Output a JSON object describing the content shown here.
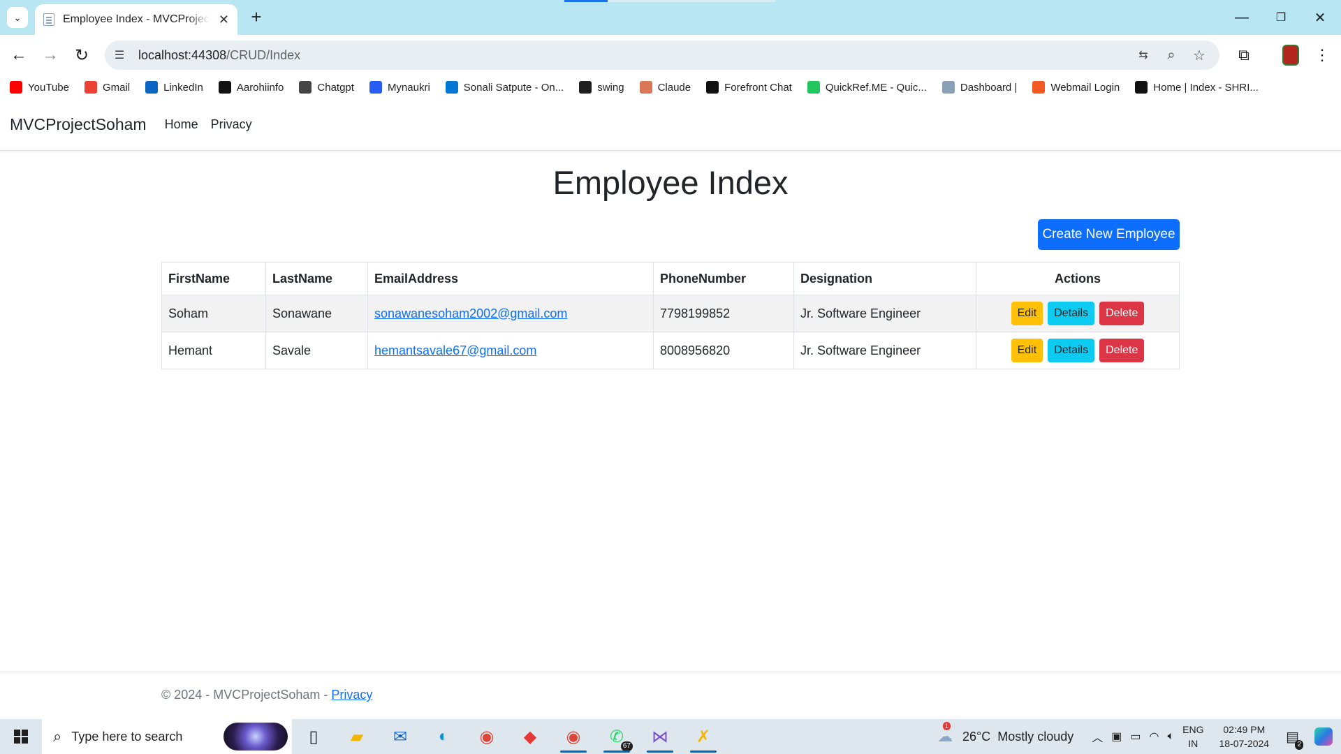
{
  "browser": {
    "tab_title": "Employee Index - MVCProjectSoham",
    "url_host": "localhost:44308",
    "url_path": "/CRUD/Index",
    "bookmarks": [
      {
        "label": "YouTube",
        "color": "#ff0000",
        "icon": "youtube-icon"
      },
      {
        "label": "Gmail",
        "color": "#ea4335",
        "icon": "gmail-icon"
      },
      {
        "label": "LinkedIn",
        "color": "#0a66c2",
        "icon": "linkedin-icon"
      },
      {
        "label": "Aarohiinfo",
        "color": "#111111",
        "icon": "aarohiinfo-icon"
      },
      {
        "label": "Chatgpt",
        "color": "#444444",
        "icon": "chatgpt-icon"
      },
      {
        "label": "Mynaukri",
        "color": "#275df5",
        "icon": "mynaukri-icon"
      },
      {
        "label": "Sonali Satpute - On...",
        "color": "#0078d4",
        "icon": "onedrive-icon"
      },
      {
        "label": "swing",
        "color": "#1f1f1f",
        "icon": "github-icon"
      },
      {
        "label": "Claude",
        "color": "#d97757",
        "icon": "claude-icon"
      },
      {
        "label": "Forefront Chat",
        "color": "#111111",
        "icon": "forefront-icon"
      },
      {
        "label": "QuickRef.ME - Quic...",
        "color": "#22c55e",
        "icon": "quickref-icon"
      },
      {
        "label": "Dashboard |",
        "color": "#8aa0b6",
        "icon": "page-icon"
      },
      {
        "label": "Webmail Login",
        "color": "#f15a24",
        "icon": "webmail-icon"
      },
      {
        "label": "Home | Index - SHRI...",
        "color": "#111111",
        "icon": "home-h-icon"
      }
    ]
  },
  "site": {
    "brand": "MVCProjectSoham",
    "nav": [
      "Home",
      "Privacy"
    ],
    "heading": "Employee Index",
    "create_label": "Create New Employee",
    "table": {
      "headers": [
        "FirstName",
        "LastName",
        "EmailAddress",
        "PhoneNumber",
        "Designation",
        "Actions"
      ],
      "rows": [
        {
          "first": "Soham",
          "last": "Sonawane",
          "email": "sonawanesoham2002@gmail.com",
          "phone": "7798199852",
          "designation": "Jr. Software Engineer"
        },
        {
          "first": "Hemant",
          "last": "Savale",
          "email": "hemantsavale67@gmail.com",
          "phone": "8008956820",
          "designation": "Jr. Software Engineer"
        }
      ],
      "actions": {
        "edit": "Edit",
        "details": "Details",
        "delete": "Delete"
      }
    },
    "footer_text": "© 2024 - MVCProjectSoham - ",
    "footer_link": "Privacy"
  },
  "taskbar": {
    "search_placeholder": "Type here to search",
    "whatsapp_badge": "67",
    "weather_alert": "1",
    "temperature": "26°C",
    "weather": "Mostly cloudy",
    "lang_top": "ENG",
    "lang_bottom": "IN",
    "time": "02:49 PM",
    "date": "18-07-2024",
    "notif_count": "2"
  },
  "colors": {
    "primary": "#0d6efd",
    "warning": "#ffc107",
    "info": "#0dcaf0",
    "danger": "#dc3545",
    "tabbar": "#b9e6f3"
  }
}
